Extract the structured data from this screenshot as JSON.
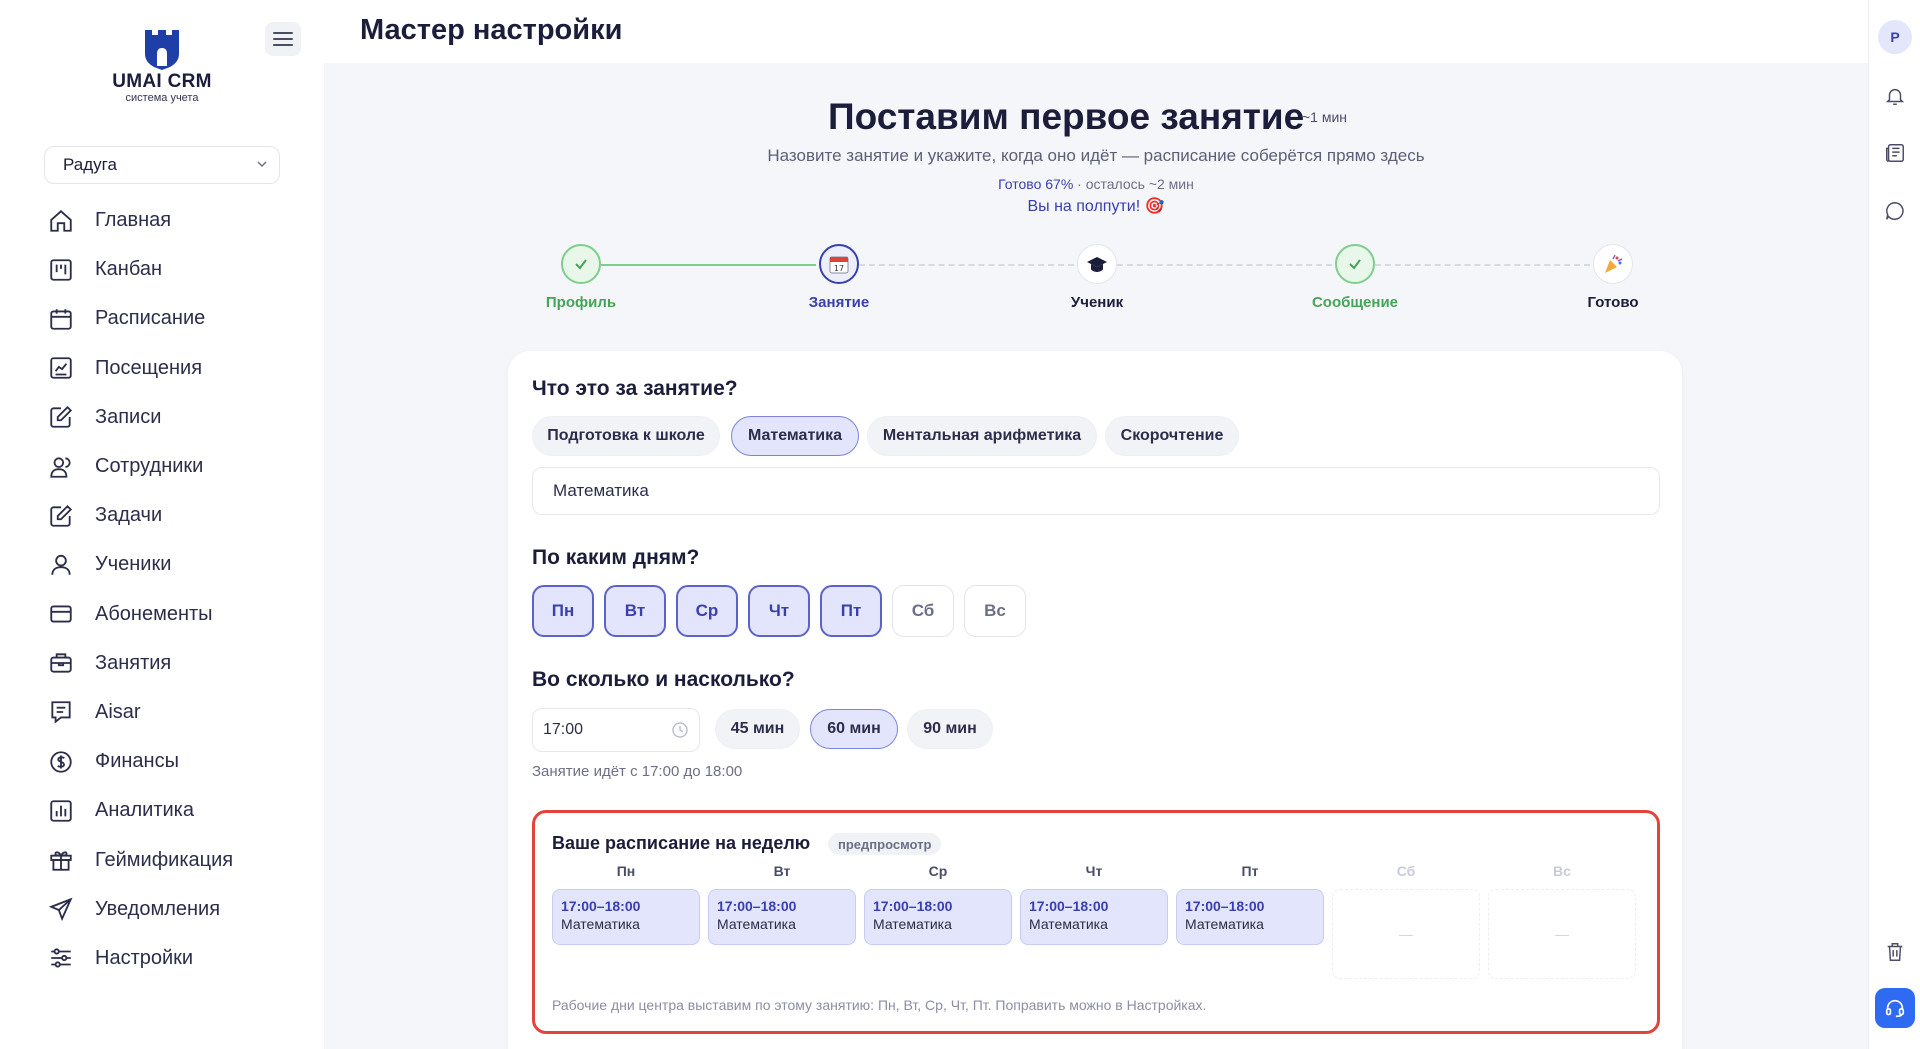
{
  "brand": {
    "name": "UMAI CRM",
    "tagline": "система учета"
  },
  "branch_select": {
    "value": "Радуга"
  },
  "sidebar": {
    "items": [
      {
        "label": "Главная",
        "icon": "home-icon"
      },
      {
        "label": "Канбан",
        "icon": "kanban-icon"
      },
      {
        "label": "Расписание",
        "icon": "calendar-icon"
      },
      {
        "label": "Посещения",
        "icon": "attendance-chart-icon"
      },
      {
        "label": "Записи",
        "icon": "edit-note-icon"
      },
      {
        "label": "Сотрудники",
        "icon": "staff-icon"
      },
      {
        "label": "Задачи",
        "icon": "tasks-edit-icon"
      },
      {
        "label": "Ученики",
        "icon": "student-icon"
      },
      {
        "label": "Абонементы",
        "icon": "card-icon"
      },
      {
        "label": "Занятия",
        "icon": "briefcase-icon"
      },
      {
        "label": "Aisar",
        "icon": "chat-doc-icon"
      },
      {
        "label": "Финансы",
        "icon": "dollar-icon"
      },
      {
        "label": "Аналитика",
        "icon": "analytics-icon"
      },
      {
        "label": "Геймификация",
        "icon": "gift-icon"
      },
      {
        "label": "Уведомления",
        "icon": "send-icon"
      },
      {
        "label": "Настройки",
        "icon": "sliders-icon"
      }
    ]
  },
  "header": {
    "title": "Мастер настройки"
  },
  "wizard": {
    "title": "Поставим первое занятие",
    "time_badge": "~1 мин",
    "subtitle": "Назовите занятие и укажите, когда оно идёт — расписание соберётся прямо здесь",
    "progress_pct": "Готово 67%",
    "progress_rest": " · осталось ~2 мин",
    "halfway": "Вы на полпути! 🎯",
    "steps": [
      {
        "label": "Профиль",
        "state": "done"
      },
      {
        "label": "Занятие",
        "state": "active"
      },
      {
        "label": "Ученик",
        "state": "todo"
      },
      {
        "label": "Сообщение",
        "state": "done"
      },
      {
        "label": "Готово",
        "state": "todo"
      }
    ]
  },
  "lesson": {
    "q_what": "Что это за занятие?",
    "presets": [
      "Подготовка к школе",
      "Математика",
      "Ментальная арифметика",
      "Скорочтение"
    ],
    "selected_preset": "Математика",
    "name_value": "Математика",
    "q_days": "По каким дням?",
    "days": [
      {
        "label": "Пн",
        "on": true
      },
      {
        "label": "Вт",
        "on": true
      },
      {
        "label": "Ср",
        "on": true
      },
      {
        "label": "Чт",
        "on": true
      },
      {
        "label": "Пт",
        "on": true
      },
      {
        "label": "Сб",
        "on": false
      },
      {
        "label": "Вс",
        "on": false
      }
    ],
    "q_time": "Во сколько и насколько?",
    "start_time": "17:00",
    "durations": [
      "45 мин",
      "60 мин",
      "90 мин"
    ],
    "selected_duration": "60 мин",
    "duration_note": "Занятие идёт с 17:00 до 18:00"
  },
  "preview": {
    "title": "Ваше расписание на неделю",
    "badge": "предпросмотр",
    "columns": [
      {
        "day": "Пн",
        "time": "17:00–18:00",
        "name": "Математика"
      },
      {
        "day": "Вт",
        "time": "17:00–18:00",
        "name": "Математика"
      },
      {
        "day": "Ср",
        "time": "17:00–18:00",
        "name": "Математика"
      },
      {
        "day": "Чт",
        "time": "17:00–18:00",
        "name": "Математика"
      },
      {
        "day": "Пт",
        "time": "17:00–18:00",
        "name": "Математика"
      },
      {
        "day": "Сб",
        "empty": "—"
      },
      {
        "day": "Вс",
        "empty": "—"
      }
    ],
    "footnote": "Рабочие дни центра выставим по этому занятию: Пн, Вт, Ср, Чт, Пт. Поправить можно в Настройках."
  },
  "rail": {
    "avatar_letter": "P"
  },
  "colors": {
    "accent": "#3a3fb0",
    "done": "#43a557",
    "highlight_border": "#e0443a",
    "support": "#2f6bf2"
  }
}
